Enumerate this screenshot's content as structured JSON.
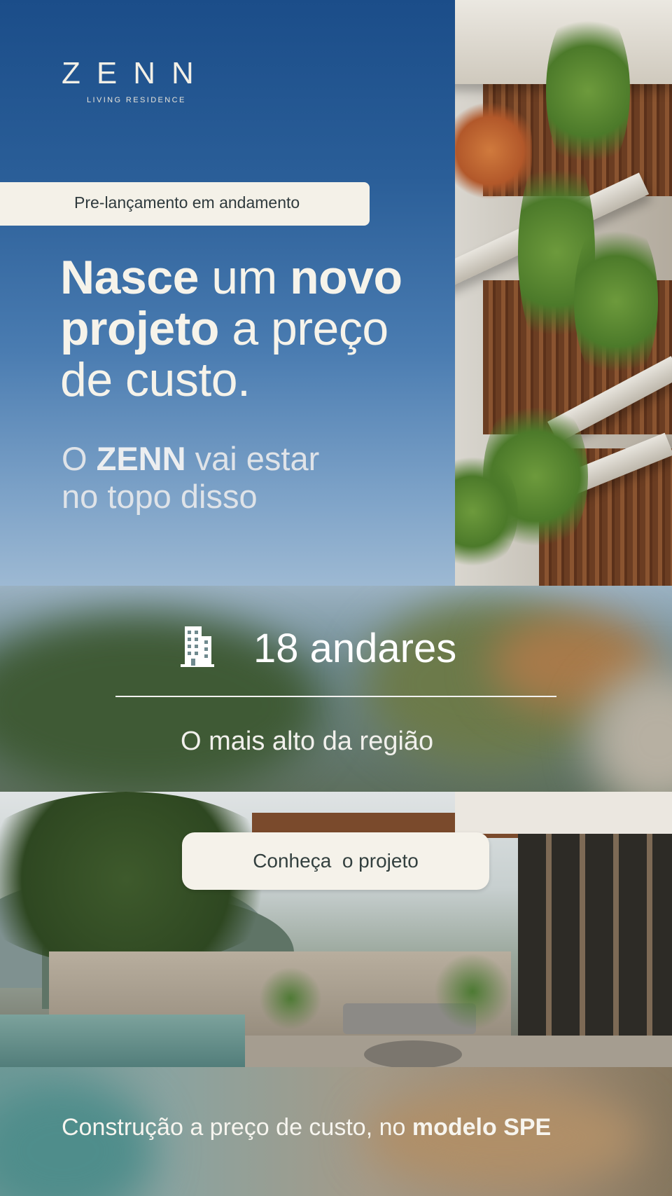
{
  "brand": {
    "name": "ZENN",
    "tagline": "LIVING RESIDENCE"
  },
  "badge": {
    "label": "Pre-lançamento em andamento"
  },
  "headline": {
    "w1": "Nasce",
    "w2": " um ",
    "w3": "novo",
    "w4": "projeto",
    "w5": " a preço",
    "w6": "de custo."
  },
  "subline": {
    "p1": "O ",
    "p2": "ZENN",
    "p3": " vai estar",
    "p4": "no topo disso"
  },
  "stat": {
    "icon": "building-icon",
    "value": "18 andares",
    "caption": "O mais alto da região"
  },
  "cta": {
    "label": "Conheça  o projeto"
  },
  "footer": {
    "text": "Construção a preço de custo, no ",
    "bold": "modelo SPE"
  },
  "colors": {
    "sky": "#2a5e98",
    "cream": "#f4f1e8",
    "dark_text": "#2f3a3d"
  }
}
